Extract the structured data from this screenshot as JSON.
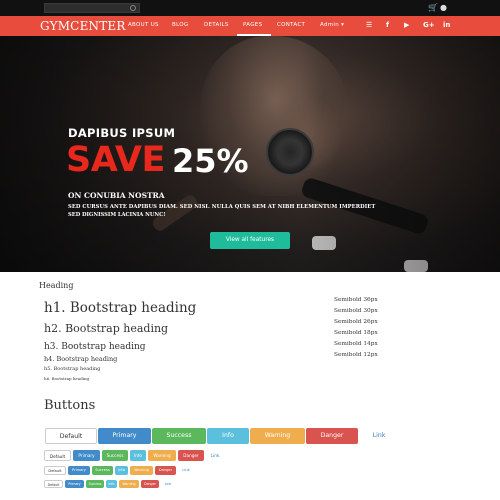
{
  "topbar": {
    "search_placeholder": "",
    "cart_icon": "cart-icon",
    "user_icon": "user-icon"
  },
  "navbar": {
    "brand": "GYMCENTER",
    "items": [
      {
        "label": "ABOUT US"
      },
      {
        "label": "BLOG"
      },
      {
        "label": "DETAILS"
      },
      {
        "label": "PAGES"
      },
      {
        "label": "CONTACT"
      },
      {
        "label": "Admin ▾"
      }
    ],
    "active_index": 3,
    "social": [
      "rss-icon",
      "facebook-icon",
      "twitter-icon",
      "google-plus-icon",
      "linkedin-icon"
    ],
    "social_glyphs": [
      "☰",
      "f",
      "▶",
      "G+",
      "in"
    ]
  },
  "hero": {
    "subtitle": "DAPIBUS IPSUM",
    "save": "SAVE",
    "percent": "25%",
    "line1": "ON CONUBIA NOSTRA",
    "line2": "SED CURSUS ANTE DAPIBUS DIAM. SED NISI. NULLA QUIS SEM AT NIBH ELEMENTUM IMPERDIET",
    "line3": "SED DIGNISSIM LACINIA NUNC!",
    "button": "View all features",
    "slides": 3,
    "active_slide": 0
  },
  "typography": {
    "section": "Heading",
    "headings": [
      "h1. Bootstrap heading",
      "h2. Bootstrap heading",
      "h3. Bootstrap heading",
      "h4. Bootstrap heading",
      "h5. Bootstrap heading",
      "h6. Bootstrap heading"
    ],
    "semibold": [
      "Semibold 36px",
      "Semibold 30px",
      "Semibold 26px",
      "Semibold 18px",
      "Semibold 14px",
      "Semibold 12px"
    ]
  },
  "buttons": {
    "title": "Buttons",
    "labels": [
      "Default",
      "Primary",
      "Success",
      "Info",
      "Warning",
      "Danger",
      "Link"
    ]
  },
  "colors": {
    "accent": "#e84c3d",
    "save": "#e8281c",
    "cta": "#1fbc9c",
    "primary": "#428bca",
    "success": "#5cb85c",
    "info": "#5bc0de",
    "warning": "#f0ad4e",
    "danger": "#d9534f",
    "link": "#3a7ec0",
    "dot_active": "#e8a24a",
    "dot": "#c77a3a"
  }
}
